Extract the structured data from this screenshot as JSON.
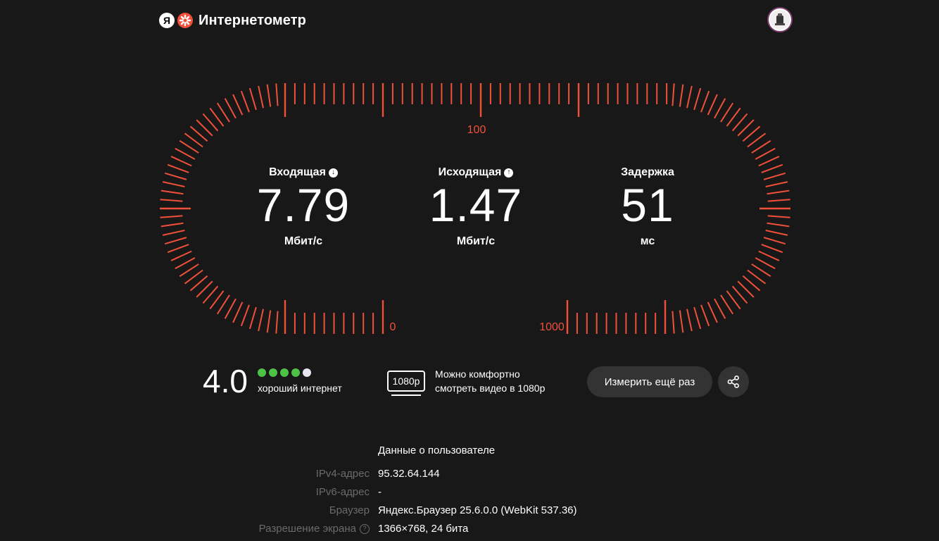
{
  "header": {
    "logo_letter": "Я",
    "title": "Интернетометр"
  },
  "gauge": {
    "label_top": "100",
    "label_zero": "0",
    "label_max": "1000",
    "color": "#f0503a"
  },
  "metrics": {
    "download": {
      "label": "Входящая",
      "value": "7.79",
      "unit": "Мбит/с",
      "icon": "arrow-down-icon"
    },
    "upload": {
      "label": "Исходящая",
      "value": "1.47",
      "unit": "Мбит/с",
      "icon": "arrow-up-icon"
    },
    "latency": {
      "label": "Задержка",
      "value": "51",
      "unit": "мс"
    }
  },
  "rating": {
    "score": "4.0",
    "label": "хороший интернет",
    "filled_dots": 4,
    "total_dots": 5,
    "dot_color": "#4dc247"
  },
  "video": {
    "badge": "1080p",
    "line1": "Можно комфортно",
    "line2": "смотреть видео в 1080р"
  },
  "actions": {
    "retest_label": "Измерить ещё раз",
    "share_icon": "share-icon"
  },
  "user_info": {
    "title": "Данные о пользователе",
    "rows": [
      {
        "key": "IPv4-адрес",
        "value": "95.32.64.144"
      },
      {
        "key": "IPv6-адрес",
        "value": "-"
      },
      {
        "key": "Браузер",
        "value": "Яндекс.Браузер 25.6.0.0 (WebKit 537.36)"
      },
      {
        "key": "Разрешение экрана",
        "value": "1366×768, 24 бита"
      }
    ]
  }
}
